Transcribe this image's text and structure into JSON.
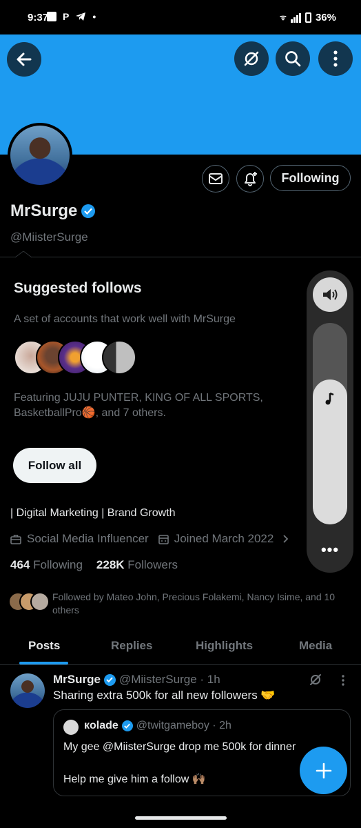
{
  "status_bar": {
    "time": "9:37",
    "battery": "36%"
  },
  "profile": {
    "name": "MrSurge",
    "handle": "@MiisterSurge",
    "following_button": "Following",
    "bio": "| Digital Marketing  | Brand Growth",
    "category": "Social Media Influencer",
    "joined": "Joined March 2022",
    "following_count": "464",
    "following_label": "Following",
    "followers_count": "228K",
    "followers_label": "Followers",
    "followed_by": "Followed by Mateo John, Precious Folakemi, Nancy Isime, and 10 others"
  },
  "suggested": {
    "title": "Suggested follows",
    "description": "A set of accounts that work well with MrSurge",
    "featuring_line1": "Featuring JUJU PUNTER, KING OF ALL SPORTS,",
    "featuring_line2": "BasketballPro🏀, and 7 others.",
    "follow_all": "Follow all"
  },
  "tabs": [
    {
      "label": "Posts",
      "active": true
    },
    {
      "label": "Replies",
      "active": false
    },
    {
      "label": "Highlights",
      "active": false
    },
    {
      "label": "Media",
      "active": false
    }
  ],
  "post": {
    "name": "MrSurge",
    "handle_time": "@MiisterSurge · 1h",
    "text": "Sharing extra 500k for all new followers 🤝",
    "quote": {
      "name": "кolade",
      "handle_time": "@twitgameboy · 2h",
      "line1": "My gee @MiisterSurge drop me 500k for dinner",
      "line2": "Help me give him a follow 🙌🏽"
    }
  },
  "volume": {
    "level": 0.72
  },
  "colors": {
    "accent": "#1d9bf0",
    "background": "#000000",
    "text_primary": "#e7e9ea",
    "text_secondary": "#71767b",
    "border": "#2f3336"
  }
}
